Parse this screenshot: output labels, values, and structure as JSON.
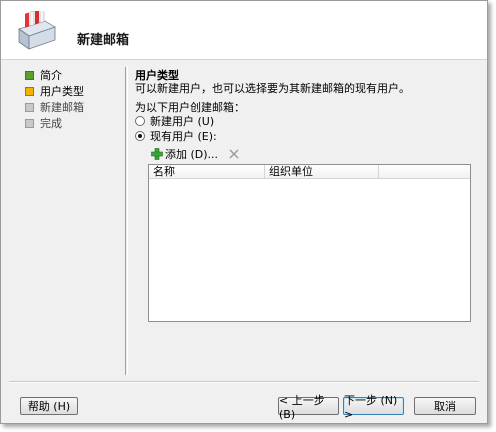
{
  "window": {
    "title": "新建邮箱"
  },
  "nav": {
    "items": [
      {
        "label": "简介",
        "state": "done"
      },
      {
        "label": "用户类型",
        "state": "current"
      },
      {
        "label": "新建邮箱",
        "state": "pending"
      },
      {
        "label": "完成",
        "state": "pending"
      }
    ]
  },
  "content": {
    "section_title": "用户类型",
    "section_desc": "可以新建用户，也可以选择要为其新建邮箱的现有用户。",
    "radio_group_label": "为以下用户创建邮箱：",
    "radio_new_user": "新建用户 (U)",
    "radio_existing_user": "现有用户 (E):",
    "selected": "existing"
  },
  "toolbar": {
    "add_label": "添加 (D)..."
  },
  "grid": {
    "columns": [
      "名称",
      "组织单位"
    ],
    "rows": []
  },
  "footer": {
    "help": "帮助 (H)",
    "back": "< 上一步 (B)",
    "next": "下一步 (N) >",
    "cancel": "取消"
  }
}
